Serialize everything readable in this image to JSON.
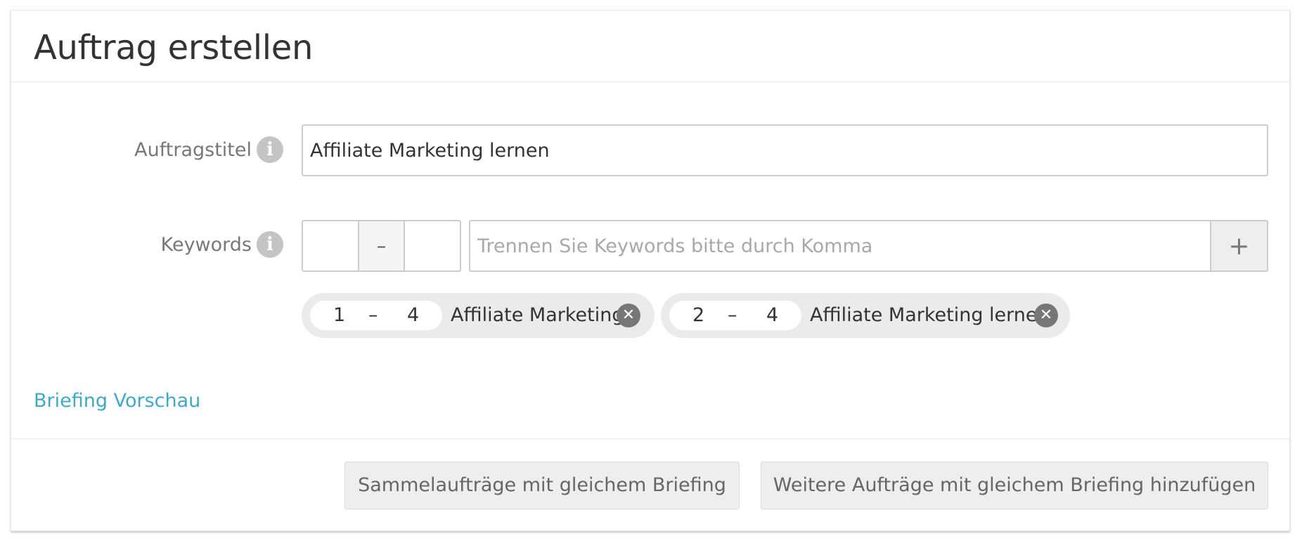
{
  "header": {
    "title": "Auftrag erstellen"
  },
  "form": {
    "title_field": {
      "label": "Auftragstitel",
      "info_icon": "i",
      "value": "Affiliate Marketing lernen"
    },
    "keywords_field": {
      "label": "Keywords",
      "info_icon": "i",
      "range_dash": "–",
      "placeholder": "Trennen Sie Keywords bitte durch Komma",
      "add_symbol": "+"
    },
    "keywords": [
      {
        "min": "1",
        "dash": "–",
        "max": "4",
        "label": "Affiliate Marketing",
        "remove": "✕"
      },
      {
        "min": "2",
        "dash": "–",
        "max": "4",
        "label": "Affiliate Marketing lernen",
        "remove": "✕"
      }
    ]
  },
  "links": {
    "briefing_preview": "Briefing Vorschau"
  },
  "footer": {
    "bulk_button": "Sammelaufträge mit gleichem Briefing",
    "more_button": "Weitere Aufträge mit gleichem Briefing hinzufügen"
  },
  "colors": {
    "link": "#3fa9c9",
    "chip_bg": "#ebebeb",
    "button_bg": "#eeeeee"
  },
  "icons": {
    "info": "info-icon",
    "add": "plus-icon",
    "remove": "close-circle-icon"
  }
}
